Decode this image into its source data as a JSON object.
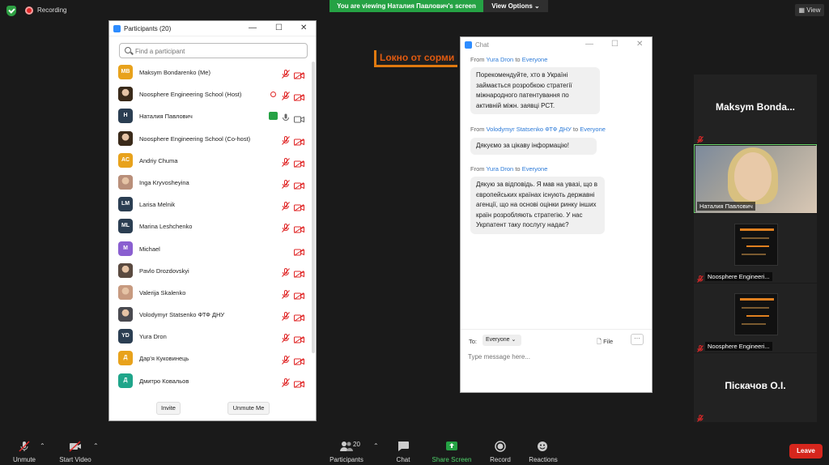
{
  "topbar": {
    "recording_label": "Recording",
    "viewing_banner": "You are viewing Наталия Павлович's screen",
    "view_options_label": "View Options",
    "view_label": "View"
  },
  "shared_screen": {
    "visible_text": "Lокно от сорми"
  },
  "participants_panel": {
    "title": "Participants (20)",
    "search_placeholder": "Find a participant",
    "participants": [
      {
        "name": "Maksym Bondarenko (Me)",
        "initials": "MB",
        "avatar_color": "#e8a21c"
      },
      {
        "name": "Noosphere Engineering School (Host)",
        "initials": "",
        "avatar_color": "#3a2a1a"
      },
      {
        "name": "Наталия Павлович",
        "initials": "Н",
        "avatar_color": "#2b3e52"
      },
      {
        "name": "Noosphere Engineering School (Co-host)",
        "initials": "",
        "avatar_color": "#3a2a1a"
      },
      {
        "name": "Andriy Chuma",
        "initials": "AC",
        "avatar_color": "#e8a21c"
      },
      {
        "name": "Inga Kryvosheyina",
        "initials": "",
        "avatar_color": "#b98f7a"
      },
      {
        "name": "Larisa Melnik",
        "initials": "LM",
        "avatar_color": "#2b3e52"
      },
      {
        "name": "Marina Leshchenko",
        "initials": "ML",
        "avatar_color": "#2b3e52"
      },
      {
        "name": "Michael",
        "initials": "M",
        "avatar_color": "#8a5fd0"
      },
      {
        "name": "Pavlo Drozdovskyi",
        "initials": "",
        "avatar_color": "#5a4a40"
      },
      {
        "name": "Valerija Skalenko",
        "initials": "",
        "avatar_color": "#c79a80"
      },
      {
        "name": "Volodymyr Statsenko ФТФ ДНУ",
        "initials": "",
        "avatar_color": "#4a4a50"
      },
      {
        "name": "Yura Dron",
        "initials": "YD",
        "avatar_color": "#2b3e52"
      },
      {
        "name": "Дар'я Куковинець",
        "initials": "Д",
        "avatar_color": "#e8a21c"
      },
      {
        "name": "Дмитро Ковальов",
        "initials": "Д",
        "avatar_color": "#1fa58a"
      }
    ],
    "invite_label": "Invite",
    "unmute_me_label": "Unmute Me"
  },
  "chat_panel": {
    "title": "Chat",
    "messages": [
      {
        "from": "Yura Dron",
        "to": "Everyone",
        "text": "Порекомендуйте, хто в Україні займається розробкою стратегії міжнародного патентування по активній міжн. заявці РСТ."
      },
      {
        "from": "Volodymyr Statsenko ФТФ ДНУ",
        "to": "Everyone",
        "text": "Дякуємо за цікаву інформацію!"
      },
      {
        "from": "Yura Dron",
        "to": "Everyone",
        "text": "Дякую за відповідь.  Я мав на увазі, що в європейських країнах існують державні агенції, що на основі оцінки ринку інших країн розробляють стратегію. У нас Укрпатент таку послугу надає?"
      }
    ],
    "from_word": "From",
    "to_word": "to",
    "to_label": "To:",
    "to_value": "Everyone",
    "file_label": "File",
    "more_label": "···",
    "input_placeholder": "Type message here..."
  },
  "video_tiles": [
    {
      "name": "Maksym  Bonda...",
      "type": "name"
    },
    {
      "name": "Наталия Павлович",
      "type": "video"
    },
    {
      "name": "Noosphere Engineeri...",
      "type": "screen"
    },
    {
      "name": "Noosphere Engineeri...",
      "type": "screen"
    },
    {
      "name": "Піскачов О.І.",
      "type": "name"
    }
  ],
  "toolbar": {
    "unmute_label": "Unmute",
    "start_video_label": "Start Video",
    "participants_label": "Participants",
    "participants_count": "20",
    "chat_label": "Chat",
    "share_screen_label": "Share Screen",
    "record_label": "Record",
    "reactions_label": "Reactions",
    "leave_label": "Leave"
  },
  "colors": {
    "accent_green": "#25a244",
    "leave_red": "#d6261d",
    "link_blue": "#2d7bd8",
    "muted_red": "#e02828"
  }
}
